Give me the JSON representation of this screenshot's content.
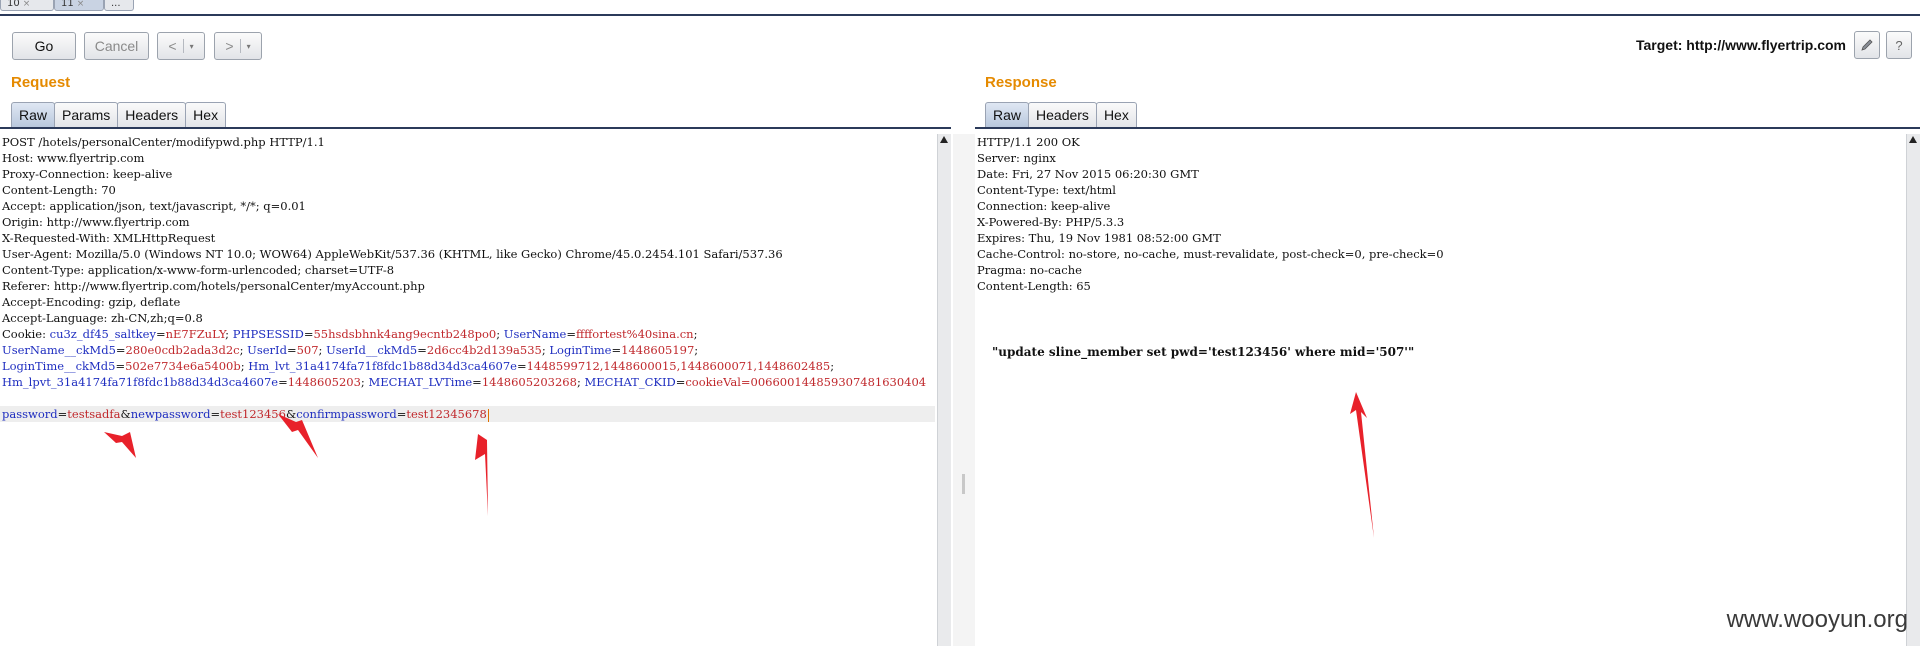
{
  "top_tabs": [
    {
      "label": "10",
      "close": "×"
    },
    {
      "label": "11",
      "close": "×"
    },
    {
      "label": "..."
    }
  ],
  "toolbar": {
    "go_label": "Go",
    "cancel_label": "Cancel",
    "back_label": "<",
    "forward_label": ">",
    "dropdown_glyph": "▾",
    "target_text": "Target: http://www.flyertrip.com",
    "help_label": "?"
  },
  "request": {
    "title": "Request",
    "tabs": [
      "Raw",
      "Params",
      "Headers",
      "Hex"
    ],
    "active_tab": "Raw",
    "lines": [
      "POST /hotels/personalCenter/modifypwd.php HTTP/1.1",
      "Host: www.flyertrip.com",
      "Proxy-Connection: keep-alive",
      "Content-Length: 70",
      "Accept: application/json, text/javascript, */*; q=0.01",
      "Origin: http://www.flyertrip.com",
      "X-Requested-With: XMLHttpRequest",
      "User-Agent: Mozilla/5.0 (Windows NT 10.0; WOW64) AppleWebKit/537.36 (KHTML, like Gecko) Chrome/45.0.2454.101 Safari/537.36",
      "Content-Type: application/x-www-form-urlencoded; charset=UTF-8",
      "Referer: http://www.flyertrip.com/hotels/personalCenter/myAccount.php",
      "Accept-Encoding: gzip, deflate",
      "Accept-Language: zh-CN,zh;q=0.8"
    ],
    "cookie_label": "Cookie: ",
    "cookie_lines": [
      [
        [
          "cu3z_df45_saltkey",
          "nE7FZuLY"
        ],
        [
          "PHPSESSID",
          "55hsdsbhnk4ang9ecntb248po0"
        ],
        [
          "UserName",
          "ffffortest%40sina.cn"
        ]
      ],
      [
        [
          "UserName__ckMd5",
          "280e0cdb2ada3d2c"
        ],
        [
          "UserId",
          "507"
        ],
        [
          "UserId__ckMd5",
          "2d6cc4b2d139a535"
        ],
        [
          "LoginTime",
          "1448605197"
        ]
      ],
      [
        [
          "LoginTime__ckMd5",
          "502e7734e6a5400b"
        ],
        [
          "Hm_lvt_31a4174fa71f8fdc1b88d34d3ca4607e",
          "1448599712,1448600015,1448600071,1448602485"
        ]
      ],
      [
        [
          "Hm_lpvt_31a4174fa71f8fdc1b88d34d3ca4607e",
          "1448605203"
        ],
        [
          "MECHAT_LVTime",
          "1448605203268"
        ],
        [
          "MECHAT_CKID",
          "cookieVal=006600144859307481630404"
        ]
      ]
    ],
    "body_params": [
      [
        "password",
        "testsadfa"
      ],
      [
        "newpassword",
        "test123456"
      ],
      [
        "confirmpassword",
        "test12345678"
      ]
    ]
  },
  "response": {
    "title": "Response",
    "tabs": [
      "Raw",
      "Headers",
      "Hex"
    ],
    "active_tab": "Raw",
    "lines": [
      "HTTP/1.1 200 OK",
      "Server: nginx",
      "Date: Fri, 27 Nov 2015 06:20:30 GMT",
      "Content-Type: text/html",
      "Connection: keep-alive",
      "X-Powered-By: PHP/5.3.3",
      "Expires: Thu, 19 Nov 1981 08:52:00 GMT",
      "Cache-Control: no-store, no-cache, must-revalidate, post-check=0, pre-check=0",
      "Pragma: no-cache",
      "Content-Length: 65"
    ],
    "body": "\"update sline_member set pwd='test123456' where mid='507'\""
  },
  "annotation_color": "#e8212a",
  "key_color": "#1f2ec0",
  "value_color": "#c0282c",
  "watermark": "www.wooyun.org"
}
